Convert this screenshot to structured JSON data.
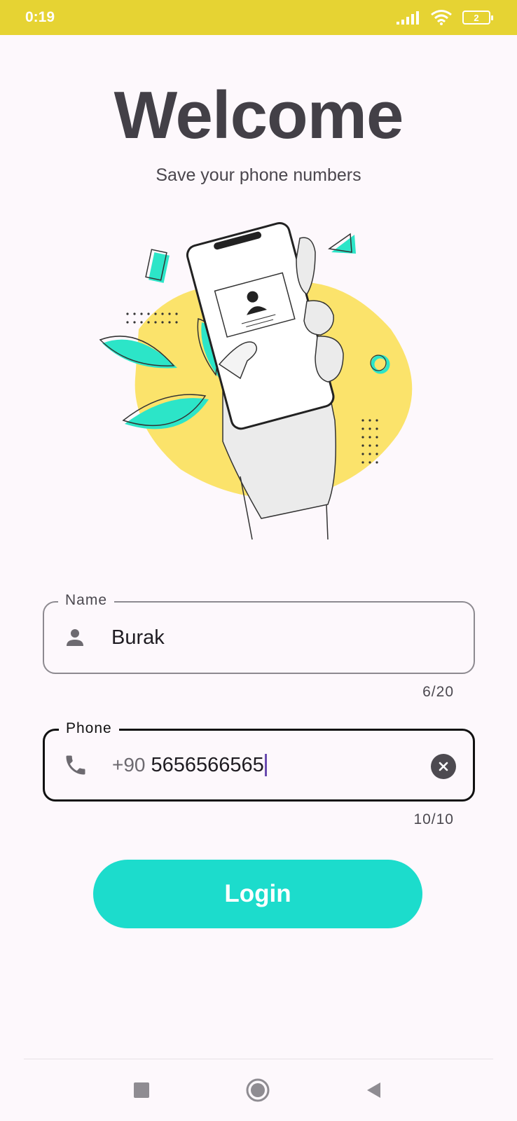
{
  "status_bar": {
    "time": "0:19",
    "battery_level": "2",
    "icons": [
      "signal-icon",
      "wifi-icon",
      "battery-icon"
    ]
  },
  "header": {
    "title": "Welcome",
    "subtitle": "Save your phone numbers"
  },
  "illustration": {
    "icon": "hand-holding-phone-illustration"
  },
  "name_field": {
    "label": "Name",
    "value": "Burak",
    "icon": "person-icon",
    "counter": "6/20"
  },
  "phone_field": {
    "label": "Phone",
    "prefix": "+90",
    "value": "5656566565",
    "icon": "phone-icon",
    "counter": "10/10",
    "clear_icon": "clear-icon"
  },
  "login_button": {
    "label": "Login"
  },
  "nav_bar": {
    "buttons": [
      "recents-square-icon",
      "home-circle-icon",
      "back-triangle-icon"
    ]
  },
  "colors": {
    "status_bar": "#e6d333",
    "background": "#fdf8fc",
    "accent": "#1cdccc",
    "illustration_yellow": "#fbe36b",
    "illustration_teal": "#2ce5c8"
  }
}
